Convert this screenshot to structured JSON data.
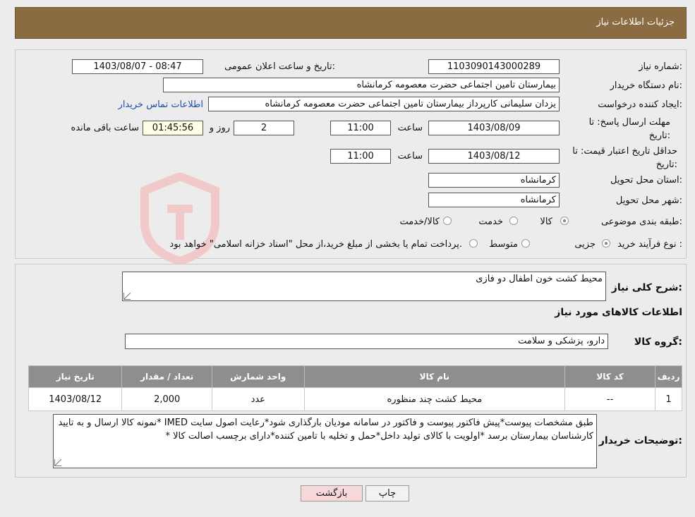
{
  "header": {
    "title": "جزئیات اطلاعات نیاز"
  },
  "info": {
    "need_number_label": "شماره نیاز:",
    "need_number": "1103090143000289",
    "announce_label": "تاریخ و ساعت اعلان عمومی:",
    "announce_value": "1403/08/07 - 08:47",
    "buyer_label": "نام دستگاه خریدار:",
    "buyer_value": "بیمارستان تامین اجتماعی حضرت معصومه کرمانشاه",
    "creator_label": "ایجاد کننده درخواست:",
    "creator_value": "یزدان  سلیمانی کارپرداز بیمارستان تامین اجتماعی حضرت معصومه کرمانشاه",
    "contact_link": "اطلاعات تماس خریدار",
    "deadline_label": "مهلت ارسال پاسخ: تا تاریخ:",
    "deadline_date": "1403/08/09",
    "time_label": "ساعت",
    "deadline_time": "11:00",
    "days_value": "2",
    "days_label": "روز و",
    "remaining_time": "01:45:56",
    "remaining_label": "ساعت باقی مانده",
    "validity_label": "حداقل تاریخ اعتبار قیمت: تا تاریخ:",
    "validity_date": "1403/08/12",
    "validity_time": "11:00",
    "province_label": "استان محل تحویل:",
    "province_value": "کرمانشاه",
    "city_label": "شهر محل تحویل:",
    "city_value": "کرمانشاه",
    "category_label": "طبقه بندی موضوعی:",
    "category_options": [
      "کالا",
      "خدمت",
      "کالا/خدمت"
    ],
    "process_label": "نوع فرآیند خرید :",
    "process_options": [
      "جزیی",
      "متوسط"
    ],
    "process_note": "پرداخت تمام یا بخشی از مبلغ خرید،از محل \"اسناد خزانه اسلامی\" خواهد بود."
  },
  "description": {
    "label": "شرح کلی نیاز:",
    "value": "محیط کشت خون اطفال دو فازی",
    "goods_heading": "اطلاعات کالاهای مورد نیاز",
    "group_label": "گروه کالا:",
    "group_value": "دارو، پزشکی و سلامت"
  },
  "table": {
    "headers": [
      "ردیف",
      "کد کالا",
      "نام کالا",
      "واحد شمارش",
      "تعداد / مقدار",
      "تاریخ نیاز"
    ],
    "rows": [
      [
        "1",
        "--",
        "محیط کشت چند منظوره",
        "عدد",
        "2,000",
        "1403/08/12"
      ]
    ]
  },
  "buyer_notes": {
    "label": "توضیحات خریدار:",
    "value": "طبق مشخصات پیوست*پیش فاکتور پیوست و فاکتور در سامانه مودیان بارگذاری شود*رعایت اصول سایت IMED *نمونه کالا ارسال و به تایید کارشناسان بیمارستان برسد *اولویت با کالای تولید داخل*حمل و تخلیه با تامین کننده*دارای برچسب اصالت کالا *"
  },
  "buttons": {
    "print": "چاپ",
    "back": "بازگشت"
  },
  "colors": {
    "header": "#8b6c42",
    "table_header": "#8e8e8e",
    "link": "#1f4ea8",
    "back_button": "#f7d9dc"
  }
}
